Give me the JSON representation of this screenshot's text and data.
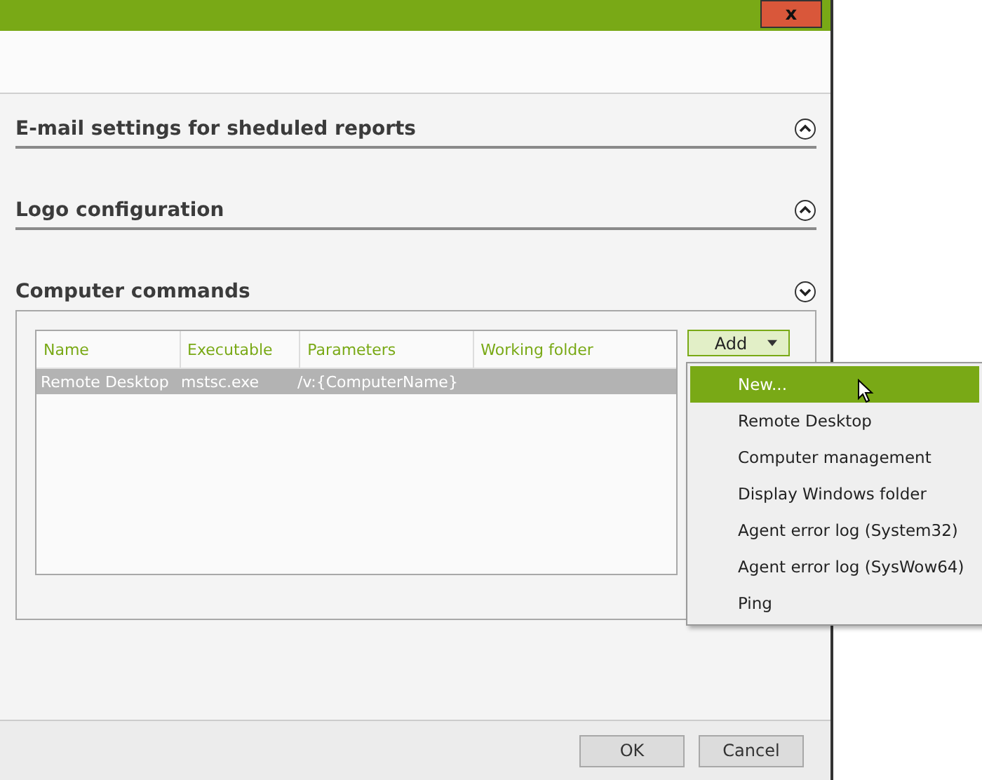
{
  "window": {
    "close": "x"
  },
  "sections": [
    {
      "title": "E-mail settings for sheduled reports",
      "expanded": false
    },
    {
      "title": "Logo configuration",
      "expanded": false
    },
    {
      "title": "Computer commands",
      "expanded": true
    }
  ],
  "table": {
    "columns": [
      "Name",
      "Executable",
      "Parameters",
      "Working folder"
    ],
    "rows": [
      {
        "cells": [
          "Remote Desktop",
          "mstsc.exe",
          "/v:{ComputerName}",
          ""
        ],
        "selected": true
      }
    ]
  },
  "add_button": {
    "label": "Add"
  },
  "menu": [
    {
      "label": "New...",
      "selected": true
    },
    {
      "label": "Remote Desktop",
      "selected": false
    },
    {
      "label": "Computer management",
      "selected": false
    },
    {
      "label": "Display Windows folder",
      "selected": false
    },
    {
      "label": "Agent error log (System32)",
      "selected": false
    },
    {
      "label": "Agent error log (SysWow64)",
      "selected": false
    },
    {
      "label": "Ping",
      "selected": false
    }
  ],
  "buttons": [
    "OK",
    "Cancel"
  ]
}
